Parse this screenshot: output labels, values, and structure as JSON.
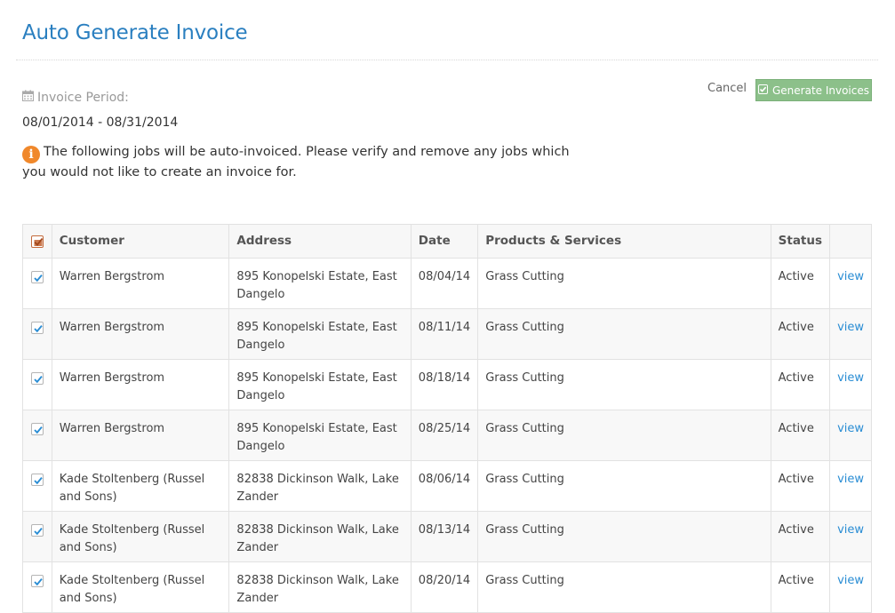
{
  "page": {
    "title": "Auto Generate Invoice"
  },
  "period": {
    "label": "Invoice Period:",
    "value": "08/01/2014 - 08/31/2014",
    "icon": "calendar-icon"
  },
  "notice": {
    "icon": "info-icon",
    "text": "The following jobs will be auto-invoiced. Please verify and remove any jobs which you would not like to create an invoice for."
  },
  "actions": {
    "cancel_label": "Cancel",
    "generate_label": "Generate Invoices"
  },
  "colors": {
    "title": "#2a7fc0",
    "generate_button": "#8cc08a",
    "info_icon": "#f0882b",
    "link": "#2a8dd4",
    "checkbox_check": "#2a8dd4",
    "header_checkbox": "#c46a3c"
  },
  "table": {
    "columns": [
      "Customer",
      "Address",
      "Date",
      "Products & Services",
      "Status",
      ""
    ],
    "header_checked": true,
    "rows": [
      {
        "checked": true,
        "customer": "Warren Bergstrom",
        "address": "895 Konopelski Estate, East Dangelo",
        "date": "08/04/14",
        "products": "Grass Cutting",
        "status": "Active",
        "link": "view"
      },
      {
        "checked": true,
        "customer": "Warren Bergstrom",
        "address": "895 Konopelski Estate, East Dangelo",
        "date": "08/11/14",
        "products": "Grass Cutting",
        "status": "Active",
        "link": "view"
      },
      {
        "checked": true,
        "customer": "Warren Bergstrom",
        "address": "895 Konopelski Estate, East Dangelo",
        "date": "08/18/14",
        "products": "Grass Cutting",
        "status": "Active",
        "link": "view"
      },
      {
        "checked": true,
        "customer": "Warren Bergstrom",
        "address": "895 Konopelski Estate, East Dangelo",
        "date": "08/25/14",
        "products": "Grass Cutting",
        "status": "Active",
        "link": "view"
      },
      {
        "checked": true,
        "customer": "Kade Stoltenberg (Russel and Sons)",
        "address": "82838 Dickinson Walk, Lake Zander",
        "date": "08/06/14",
        "products": "Grass Cutting",
        "status": "Active",
        "link": "view"
      },
      {
        "checked": true,
        "customer": "Kade Stoltenberg (Russel and Sons)",
        "address": "82838 Dickinson Walk, Lake Zander",
        "date": "08/13/14",
        "products": "Grass Cutting",
        "status": "Active",
        "link": "view"
      },
      {
        "checked": true,
        "customer": "Kade Stoltenberg (Russel and Sons)",
        "address": "82838 Dickinson Walk, Lake Zander",
        "date": "08/20/14",
        "products": "Grass Cutting",
        "status": "Active",
        "link": "view"
      }
    ]
  }
}
